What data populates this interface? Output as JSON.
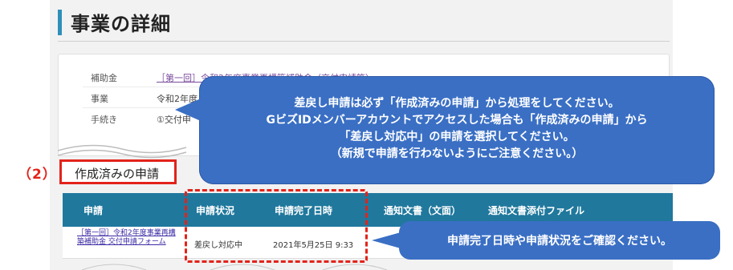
{
  "page": {
    "title": "事業の詳細"
  },
  "details": {
    "rows": [
      {
        "label": "補助金",
        "value": "［第一回］令和2年度事業再構築補助金（交付申請等）"
      },
      {
        "label": "事業",
        "value": "令和2年度"
      },
      {
        "label": "手続き",
        "value": "①交付申"
      }
    ]
  },
  "section": {
    "number": "（2）",
    "title": "作成済みの申請"
  },
  "table": {
    "headers": [
      "申請",
      "申請状況",
      "申請完了日時",
      "通知文書（文面）",
      "通知文書添付ファイル"
    ],
    "rows": [
      {
        "application": "［第一回］令和2年度事業再構築補助金 交付申請フォーム",
        "status": "差戻し対応中",
        "completed_at": "2021年5月25日 9:33"
      }
    ]
  },
  "callouts": {
    "main": [
      "差戻し申請は必ず「作成済みの申請」から処理をしてください。",
      "GビズIDメンバーアカウントでアクセスした場合も「作成済みの申請」から",
      "「差戻し対応中」の申請を選択してください。",
      "（新規で申請を行わないようにご注意ください。）"
    ],
    "secondary": "申請完了日時や申請状況をご確認ください。"
  },
  "colors": {
    "accent_red": "#e2231a",
    "table_header": "#20789d",
    "callout_blue": "#3a6fc4",
    "title_bar": "#2e8fb8"
  }
}
